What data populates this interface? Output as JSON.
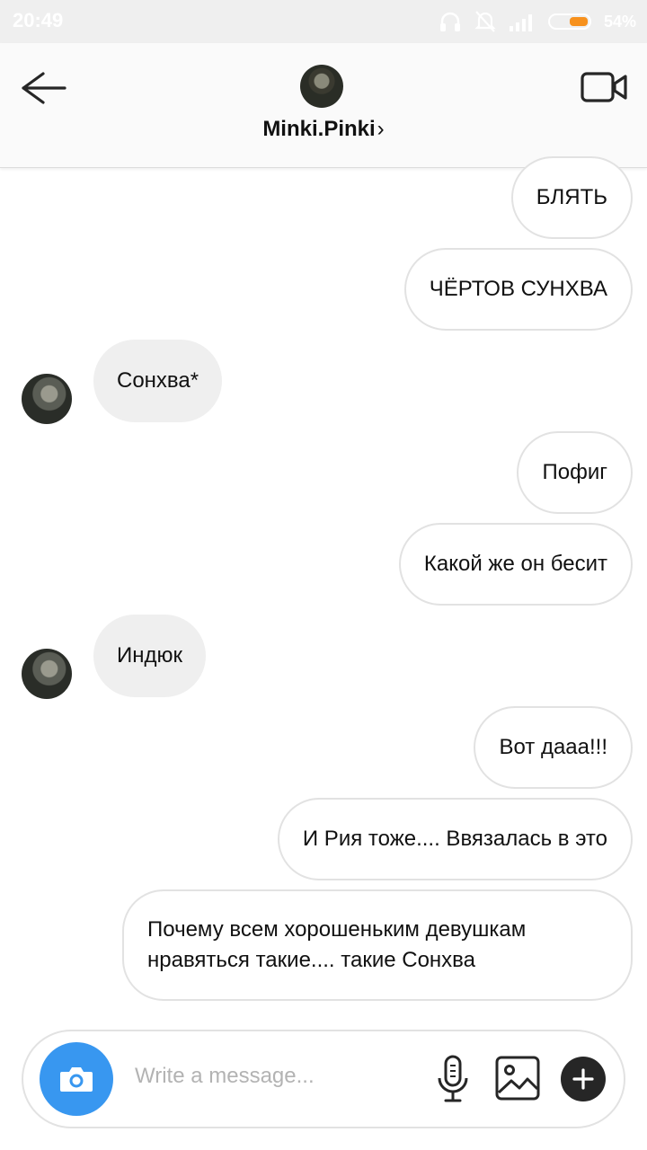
{
  "status_bar": {
    "time": "20:49",
    "battery_percent": "54%",
    "battery_level": 0.54,
    "icons": [
      "headphones-icon",
      "mute-bell-icon",
      "signal-icon",
      "battery-icon"
    ]
  },
  "header": {
    "username": "Minki.Pinki",
    "chevron": "›"
  },
  "messages": [
    {
      "direction": "outgoing",
      "text": "БЛЯТЬ"
    },
    {
      "direction": "outgoing",
      "text": "ЧЁРТОВ СУНХВА"
    },
    {
      "direction": "incoming",
      "text": "Сонхва*"
    },
    {
      "direction": "outgoing",
      "text": "Пофиг"
    },
    {
      "direction": "outgoing",
      "text": "Какой же он бесит"
    },
    {
      "direction": "incoming",
      "text": "Индюк"
    },
    {
      "direction": "outgoing",
      "text": "Вот дааа!!!"
    },
    {
      "direction": "outgoing",
      "text": "И Рия тоже.... Ввязалась в это"
    },
    {
      "direction": "outgoing",
      "text": "Почему всем хорошеньким девушкам нравяться такие.... такие Сонхва"
    }
  ],
  "composer": {
    "placeholder": "Write a message..."
  },
  "colors": {
    "accent": "#3897f0",
    "incoming_bubble": "#efefef",
    "outgoing_border": "#e2e2e2",
    "battery": "#f7911d"
  }
}
